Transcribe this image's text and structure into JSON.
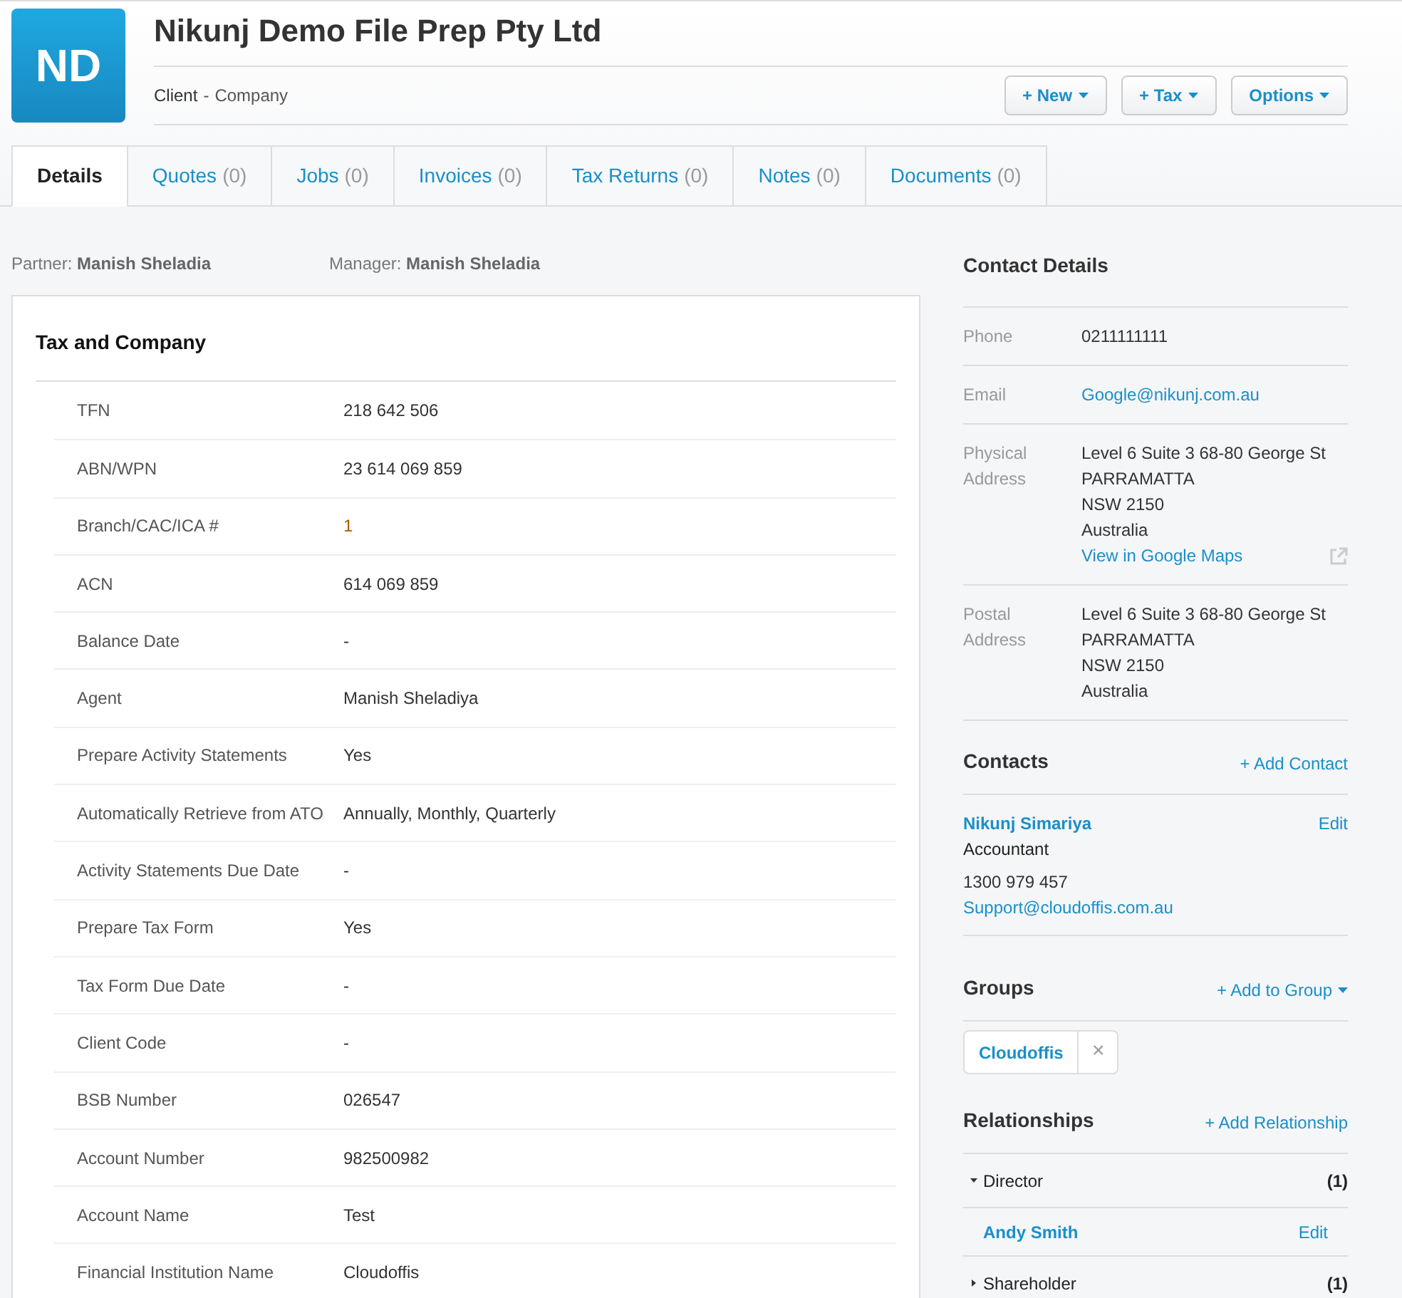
{
  "header": {
    "avatar": "ND",
    "title": "Nikunj Demo File Prep Pty Ltd",
    "client_type": "Client",
    "separator": "-",
    "client_subtype": "Company",
    "buttons": [
      {
        "label": "+ New"
      },
      {
        "label": "+ Tax"
      },
      {
        "label": "Options"
      }
    ]
  },
  "tabs": [
    {
      "label": "Details",
      "selected": true
    },
    {
      "label": "Quotes",
      "count": "(0)",
      "selected": false
    },
    {
      "label": "Jobs",
      "count": "(0)",
      "selected": false
    },
    {
      "label": "Invoices",
      "count": "(0)",
      "selected": false
    },
    {
      "label": "Tax Returns",
      "count": "(0)",
      "selected": false
    },
    {
      "label": "Notes",
      "count": "(0)",
      "selected": false
    },
    {
      "label": "Documents",
      "count": "(0)",
      "selected": false
    }
  ],
  "staff": [
    {
      "label": "Partner:",
      "name": "Manish Sheladia"
    },
    {
      "label": "Manager:",
      "name": "Manish Sheladia"
    }
  ],
  "tax_and_company": {
    "title": "Tax and Company",
    "rows": [
      {
        "label": "TFN",
        "value": "218 642 506",
        "kind": "plain"
      },
      {
        "label": "ABN/WPN",
        "value": "23 614 069 859",
        "kind": "plain"
      },
      {
        "label": "Branch/CAC/ICA #",
        "value": "1",
        "kind": "accent"
      },
      {
        "label": "ACN",
        "value": "614 069 859",
        "kind": "plain"
      },
      {
        "label": "Balance Date",
        "value": "-",
        "kind": "plain"
      },
      {
        "label": "Agent",
        "value": "Manish Sheladiya",
        "kind": "plain"
      },
      {
        "label": "Prepare Activity Statements",
        "value": "Yes",
        "kind": "plain"
      },
      {
        "label": "Automatically Retrieve from ATO",
        "value": "Annually, Monthly, Quarterly",
        "kind": "plain"
      },
      {
        "label": "Activity Statements Due Date",
        "value": "-",
        "kind": "plain"
      },
      {
        "label": "Prepare Tax Form",
        "value": "Yes",
        "kind": "plain"
      },
      {
        "label": "Tax Form Due Date",
        "value": "-",
        "kind": "plain"
      },
      {
        "label": "Client Code",
        "value": "-",
        "kind": "plain"
      },
      {
        "label": "BSB Number",
        "value": "026547",
        "kind": "plain"
      },
      {
        "label": "Account Number",
        "value": "982500982",
        "kind": "plain"
      },
      {
        "label": "Account Name",
        "value": "Test",
        "kind": "plain"
      },
      {
        "label": "Financial Institution Name",
        "value": "Cloudoffis",
        "kind": "plain"
      }
    ]
  },
  "contact_details": {
    "title": "Contact Details",
    "rows": [
      {
        "label": "Phone",
        "lines": [
          "0211111111"
        ],
        "kind": "text"
      },
      {
        "label": "Email",
        "lines": [
          "Google@nikunj.com.au"
        ],
        "kind": "link"
      },
      {
        "label": "Physical Address",
        "lines": [
          "Level 6 Suite 3 68-80 George St",
          "PARRAMATTA",
          "NSW 2150",
          "Australia"
        ],
        "map_link": "View in Google Maps",
        "kind": "text"
      },
      {
        "label": "Postal Address",
        "lines": [
          "Level 6 Suite 3 68-80 George St",
          "PARRAMATTA",
          "NSW 2150",
          "Australia"
        ],
        "kind": "text"
      }
    ]
  },
  "contacts": {
    "title": "Contacts",
    "add": "+ Add Contact",
    "items": [
      {
        "name": "Nikunj Simariya",
        "role": "Accountant",
        "phone": "1300 979 457",
        "email": "Support@cloudoffis.com.au",
        "edit": "Edit"
      }
    ]
  },
  "groups": {
    "title": "Groups",
    "add": "+ Add to Group",
    "items": [
      {
        "label": "Cloudoffis",
        "remove": "×"
      }
    ]
  },
  "relationships": {
    "title": "Relationships",
    "add": "+ Add Relationship",
    "sections": [
      {
        "label": "Director",
        "count": "(1)",
        "expanded": true,
        "items": [
          {
            "name": "Andy Smith",
            "edit": "Edit"
          }
        ]
      },
      {
        "label": "Shareholder",
        "count": "(1)",
        "expanded": false
      }
    ]
  }
}
